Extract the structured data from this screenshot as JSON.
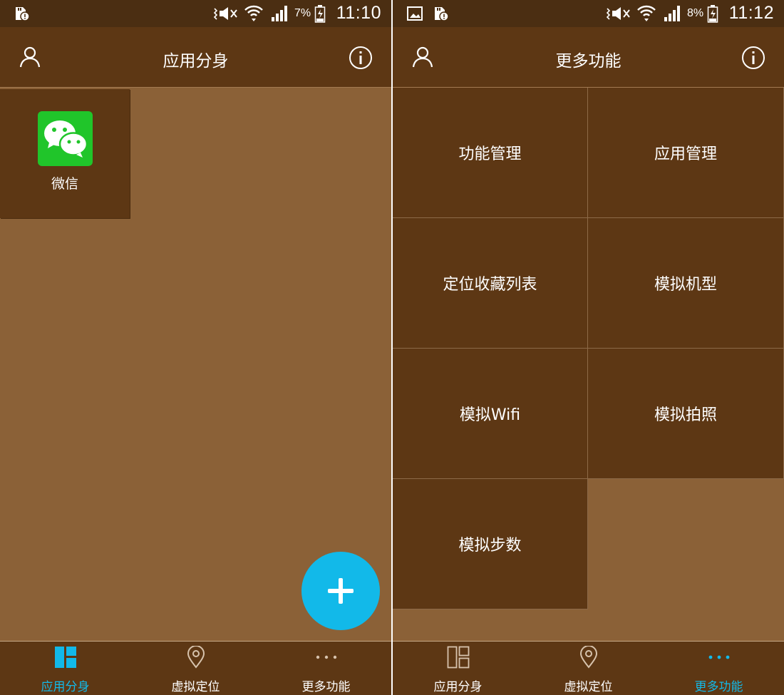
{
  "screens": {
    "left": {
      "status": {
        "battery": "7%",
        "time": "11:10"
      },
      "header": {
        "title": "应用分身"
      },
      "apps": [
        {
          "label": "微信"
        }
      ],
      "nav": [
        {
          "label": "应用分身",
          "active": true
        },
        {
          "label": "虚拟定位",
          "active": false
        },
        {
          "label": "更多功能",
          "active": false
        }
      ]
    },
    "right": {
      "status": {
        "battery": "8%",
        "time": "11:12"
      },
      "header": {
        "title": "更多功能"
      },
      "features": [
        "功能管理",
        "应用管理",
        "定位收藏列表",
        "模拟机型",
        "模拟Wifi",
        "模拟拍照",
        "模拟步数"
      ],
      "nav": [
        {
          "label": "应用分身",
          "active": false
        },
        {
          "label": "虚拟定位",
          "active": false
        },
        {
          "label": "更多功能",
          "active": true
        }
      ]
    }
  },
  "icons": {
    "status_left": [
      "sd-card-alert-icon",
      "vibrate-icon",
      "wifi-icon",
      "signal-icon",
      "battery-charging-icon"
    ],
    "status_right": [
      "image-notification-icon",
      "sd-card-alert-icon",
      "vibrate-icon",
      "wifi-icon",
      "signal-icon",
      "battery-charging-icon"
    ],
    "header": [
      "user-icon",
      "info-icon"
    ],
    "app": [
      "wechat-icon"
    ],
    "fab": "plus-icon",
    "nav": [
      "grid-layout-icon",
      "location-pin-icon",
      "more-dots-icon"
    ]
  },
  "colors": {
    "status_bar": "#4b2e12",
    "app_bar": "#5d3714",
    "background": "#8b6137",
    "tile": "#5d3714",
    "accent": "#12b9e9",
    "wechat": "#20c52a"
  }
}
